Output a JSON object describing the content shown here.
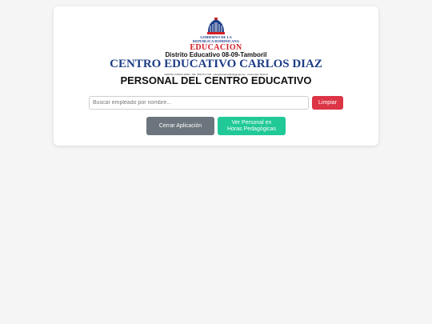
{
  "header": {
    "gov_line1": "GOBIERNO DE LA",
    "gov_line2": "REPUBLICA DOMINICANA",
    "ministry": "EDUCACION",
    "district": "Distrito Educativo 08-09-Tamboril",
    "school_name": "CENTRO EDUCATIVO CARLOS DIAZ",
    "contact_line": "CENTRO CODIGO 00000 · TEL. 809-574-7745 · educativocarlosdiaz@gmail.com · Carlos Diaz Tamboril"
  },
  "page": {
    "title": "PERSONAL DEL CENTRO EDUCATIVO"
  },
  "search": {
    "value": "",
    "placeholder": "Buscar empleado por nombre..."
  },
  "buttons": {
    "clear_label": "Limpiar",
    "close_label": "Cerrar Aplicación",
    "view_line1": "Ver Personal en",
    "view_line2": "Horas Pedagógicas"
  },
  "colors": {
    "accent_red": "#dc3545",
    "secondary_gray": "#6c757d",
    "teal": "#20c997",
    "navy": "#1d3c87"
  },
  "icons": {
    "seal": "dominican-republic-coat-of-arms-icon"
  }
}
